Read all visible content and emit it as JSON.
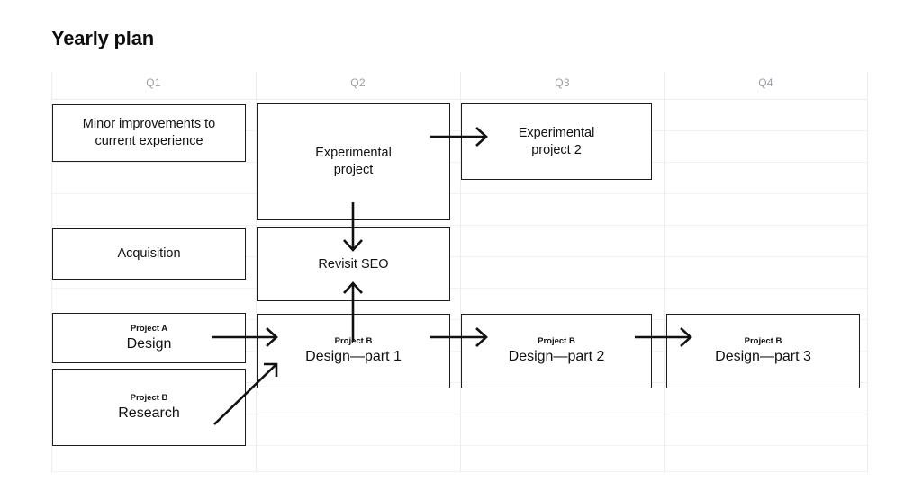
{
  "page": {
    "title": "Yearly plan"
  },
  "grid": {
    "columns": [
      {
        "label": "Q1"
      },
      {
        "label": "Q2"
      },
      {
        "label": "Q3"
      },
      {
        "label": "Q4"
      }
    ],
    "gridline_color": "#f1f2f2",
    "header_text_color": "#9aa0a6"
  },
  "cards": [
    {
      "id": "minor-improvements",
      "quarter": "Q1",
      "eyebrow": "",
      "title": "Minor improvements to\ncurrent experience"
    },
    {
      "id": "experimental-project",
      "quarter": "Q2",
      "eyebrow": "",
      "title": "Experimental\nproject"
    },
    {
      "id": "experimental-project-2",
      "quarter": "Q3",
      "eyebrow": "",
      "title": "Experimental\nproject 2"
    },
    {
      "id": "acquisition",
      "quarter": "Q1",
      "eyebrow": "",
      "title": "Acquisition"
    },
    {
      "id": "revisit-seo",
      "quarter": "Q2",
      "eyebrow": "",
      "title": "Revisit SEO"
    },
    {
      "id": "project-a-design",
      "quarter": "Q1",
      "eyebrow": "Project A",
      "title": "Design"
    },
    {
      "id": "project-b-research",
      "quarter": "Q1",
      "eyebrow": "Project B",
      "title": "Research"
    },
    {
      "id": "project-b-design-part-1",
      "quarter": "Q2",
      "eyebrow": "Project B",
      "title": "Design—part 1"
    },
    {
      "id": "project-b-design-part-2",
      "quarter": "Q3",
      "eyebrow": "Project B",
      "title": "Design—part 2"
    },
    {
      "id": "project-b-design-part-3",
      "quarter": "Q4",
      "eyebrow": "Project B",
      "title": "Design—part 3"
    }
  ],
  "connectors": [
    {
      "id": "experimental-to-experimental-2",
      "from": "experimental-project",
      "to": "experimental-project-2",
      "direction": "right"
    },
    {
      "id": "experimental-to-revisit-seo",
      "from": "experimental-project",
      "to": "revisit-seo",
      "direction": "down"
    },
    {
      "id": "design-part-1-to-revisit-seo",
      "from": "project-b-design-part-1",
      "to": "revisit-seo",
      "direction": "up"
    },
    {
      "id": "design-to-design-part-1",
      "from": "project-a-design",
      "to": "project-b-design-part-1",
      "direction": "right"
    },
    {
      "id": "research-to-design-part-1",
      "from": "project-b-research",
      "to": "project-b-design-part-1",
      "direction": "diagonal-up-right"
    },
    {
      "id": "design-part-1-to-part-2",
      "from": "project-b-design-part-1",
      "to": "project-b-design-part-2",
      "direction": "right"
    },
    {
      "id": "design-part-2-to-part-3",
      "from": "project-b-design-part-2",
      "to": "project-b-design-part-3",
      "direction": "right"
    }
  ]
}
